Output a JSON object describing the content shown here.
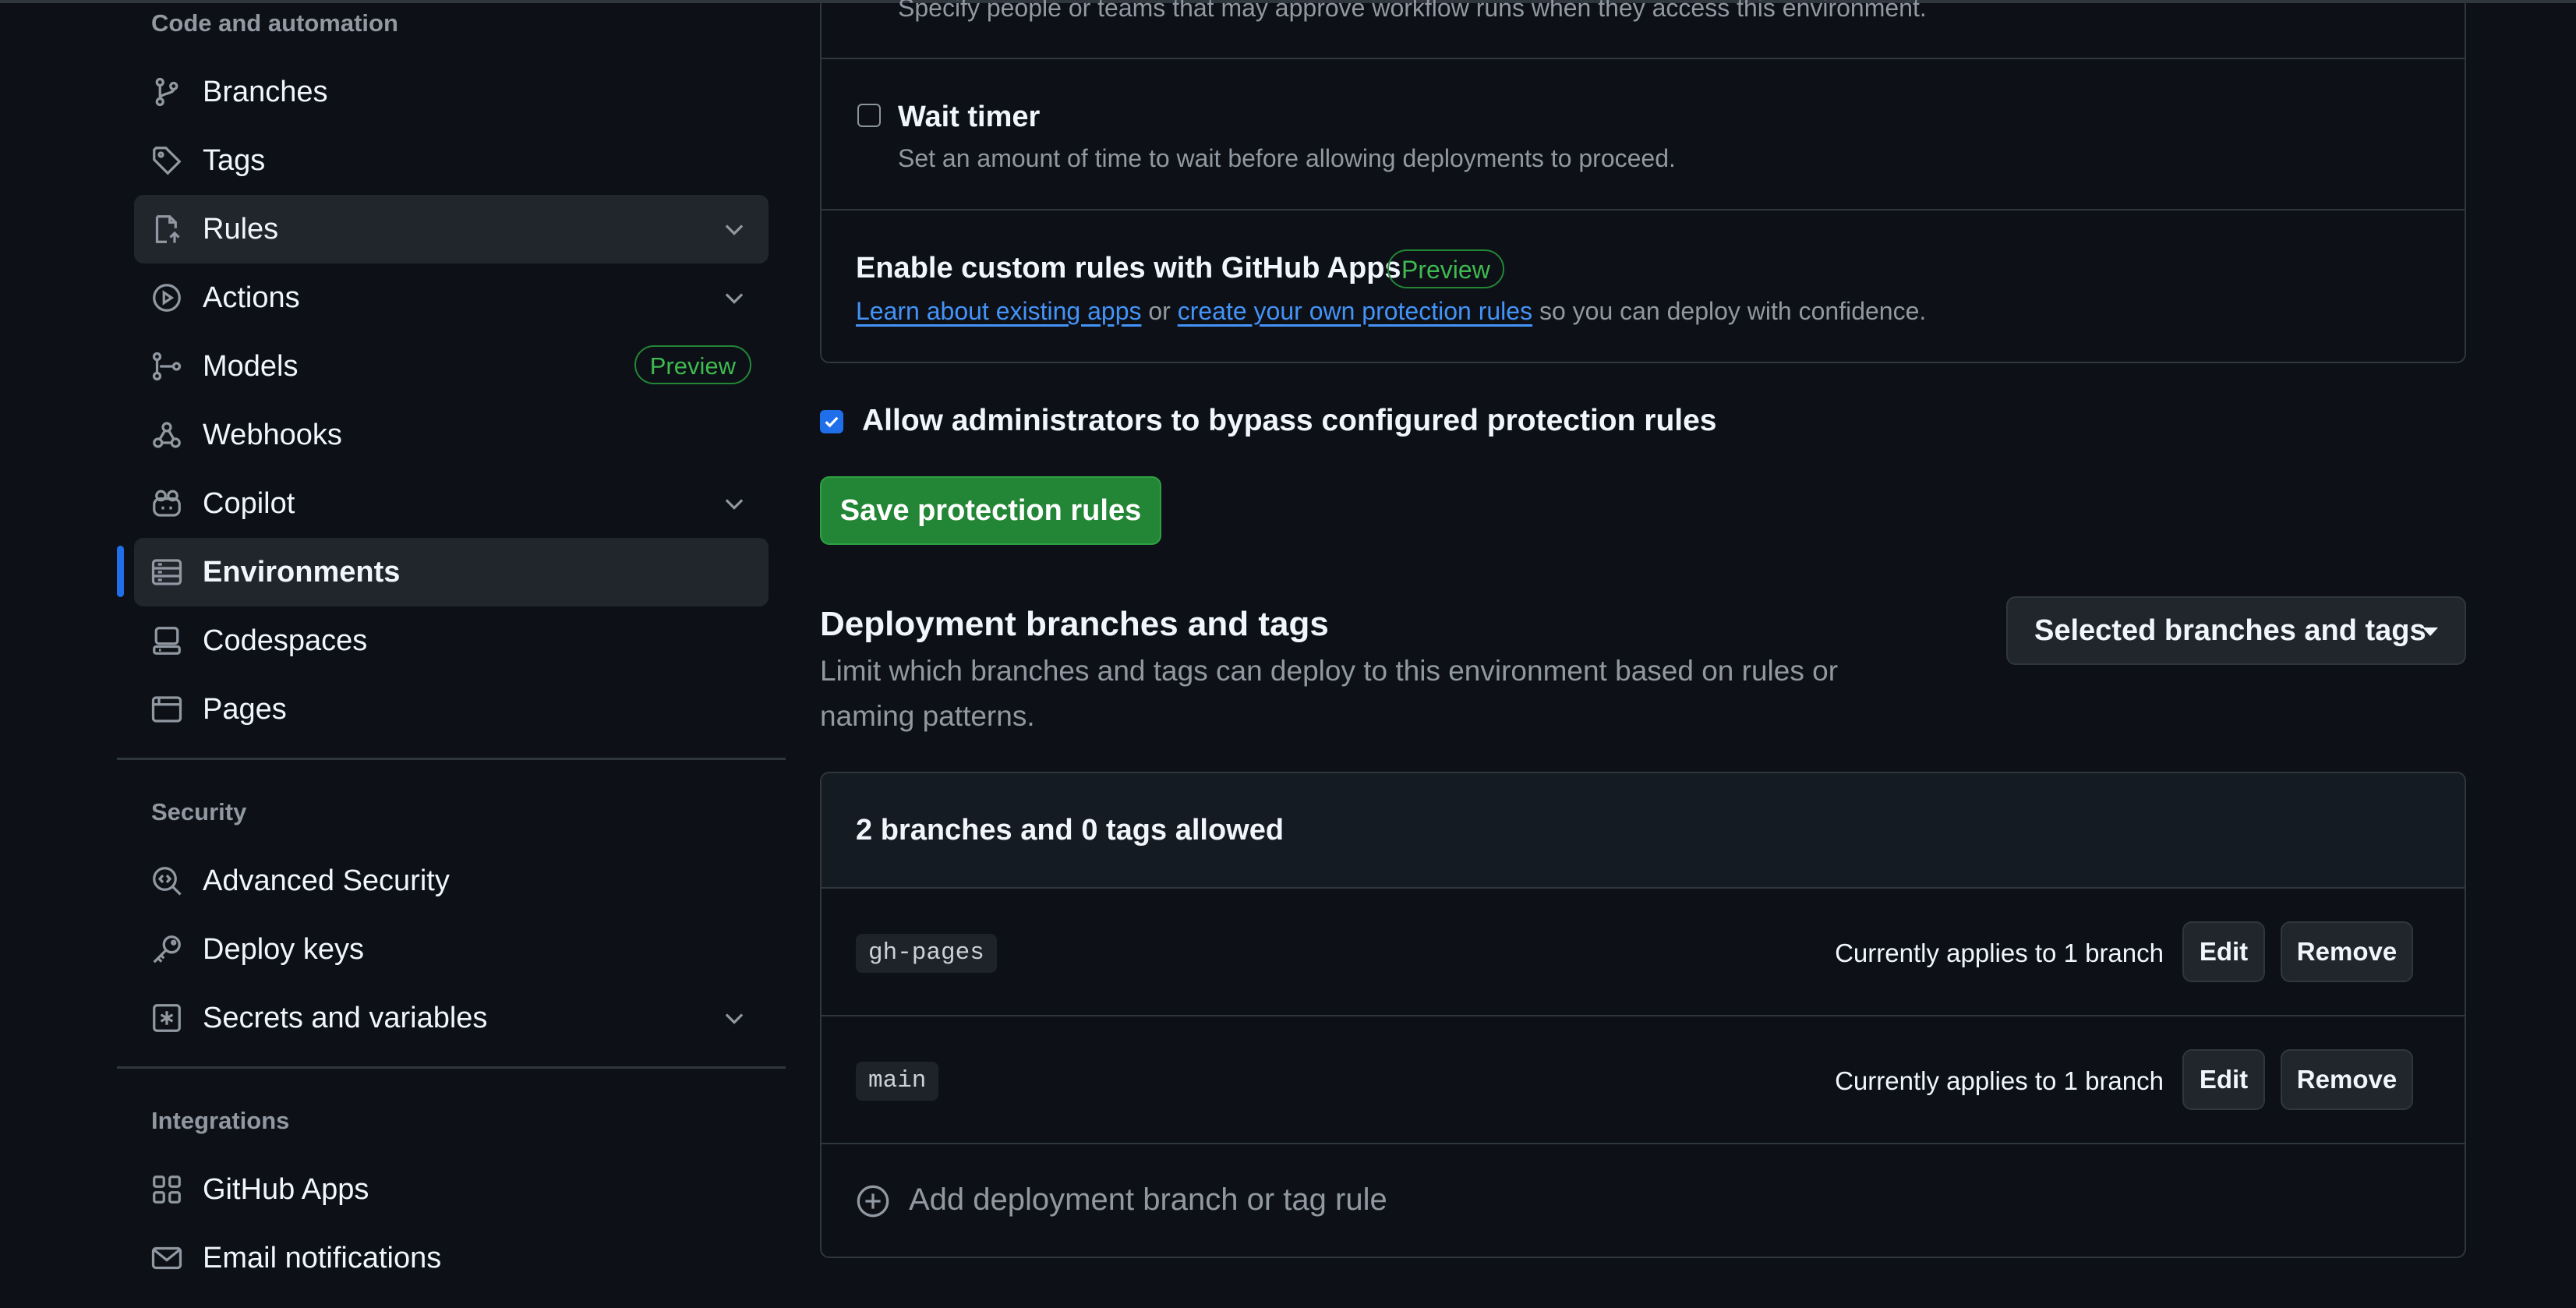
{
  "sidebar": {
    "groups": [
      {
        "title": "Code and automation"
      },
      {
        "title": "Security"
      },
      {
        "title": "Integrations"
      }
    ],
    "items": [
      {
        "label": "Branches",
        "icon": "branch-icon"
      },
      {
        "label": "Tags",
        "icon": "tag-icon"
      },
      {
        "label": "Rules",
        "icon": "rules-icon",
        "expandable": true
      },
      {
        "label": "Actions",
        "icon": "play-icon",
        "expandable": true
      },
      {
        "label": "Models",
        "icon": "models-icon",
        "badge": "Preview"
      },
      {
        "label": "Webhooks",
        "icon": "webhook-icon"
      },
      {
        "label": "Copilot",
        "icon": "copilot-icon",
        "expandable": true
      },
      {
        "label": "Environments",
        "icon": "server-icon",
        "active": true
      },
      {
        "label": "Codespaces",
        "icon": "codespaces-icon"
      },
      {
        "label": "Pages",
        "icon": "browser-icon"
      },
      {
        "label": "Advanced Security",
        "icon": "codescan-icon"
      },
      {
        "label": "Deploy keys",
        "icon": "key-icon"
      },
      {
        "label": "Secrets and variables",
        "icon": "asterisk-icon",
        "expandable": true
      },
      {
        "label": "GitHub Apps",
        "icon": "apps-icon"
      },
      {
        "label": "Email notifications",
        "icon": "mail-icon"
      }
    ]
  },
  "protection": {
    "reviewers_desc": "Specify people or teams that may approve workflow runs when they access this environment.",
    "wait_timer": {
      "label": "Wait timer",
      "desc": "Set an amount of time to wait before allowing deployments to proceed.",
      "checked": false
    },
    "custom_rules": {
      "title": "Enable custom rules with GitHub Apps",
      "badge": "Preview",
      "link1": "Learn about existing apps",
      "or": "or",
      "link2": "create your own protection rules",
      "suffix": "so you can deploy with confidence."
    },
    "admin_bypass": {
      "label": "Allow administrators to bypass configured protection rules",
      "checked": true
    },
    "save_label": "Save protection rules"
  },
  "deployment": {
    "title": "Deployment branches and tags",
    "desc_line1": "Limit which branches and tags can deploy to this environment based on rules or",
    "desc_line2": "naming patterns.",
    "select_label": "Selected branches and tags",
    "summary": "2 branches and 0 tags allowed",
    "rules": [
      {
        "pattern": "gh-pages",
        "applies": "Currently applies to 1 branch",
        "edit": "Edit",
        "remove": "Remove"
      },
      {
        "pattern": "main",
        "applies": "Currently applies to 1 branch",
        "edit": "Edit",
        "remove": "Remove"
      }
    ],
    "add_label": "Add deployment branch or tag rule"
  },
  "colors": {
    "background": "#0d1117",
    "accent": "#1f6feb",
    "success": "#238636",
    "link": "#4493f8"
  }
}
